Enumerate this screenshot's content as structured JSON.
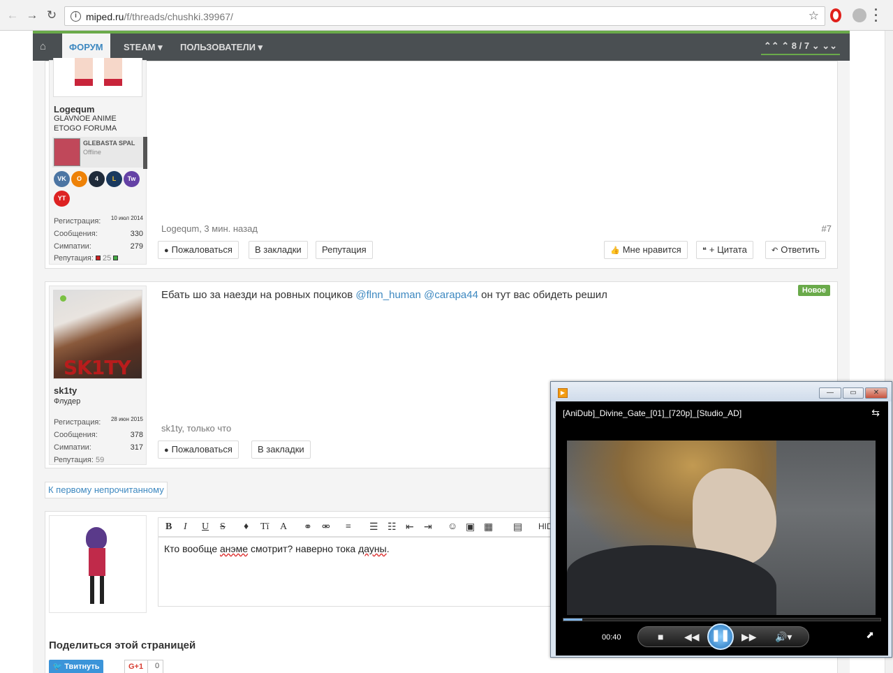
{
  "browser": {
    "url_host": "miped.ru",
    "url_path": "/f/threads/chushki.39967/"
  },
  "topnav": {
    "forum": "ФОРУМ",
    "steam": "STEAM ▾",
    "users": "ПОЛЬЗОВАТЕЛИ ▾",
    "pager": "⌃⌃ ⌃ 8 / 7 ⌄ ⌄⌄"
  },
  "post1": {
    "username": "Logequm",
    "usertitle": "GLAVNOE ANIME ETOGO FORUMA",
    "steam_name": "GLEBASTA SPAL",
    "steam_status": "Offline",
    "reg_label": "Регистрация:",
    "reg_value": "10 июл 2014",
    "msgs_label": "Сообщения:",
    "msgs_value": "330",
    "likes_label": "Симпатии:",
    "likes_value": "279",
    "rep_label": "Репутация:",
    "rep_value": "25",
    "meta": "Logequm, 3 мин. назад",
    "num": "#7",
    "report": "Пожаловаться",
    "bookmark": "В закладки",
    "reputation": "Репутация",
    "like": "Мне нравится",
    "quote": "+ Цитата",
    "reply": "Ответить",
    "social": [
      "VK",
      "O",
      "4",
      "L",
      "Tw",
      "YT"
    ]
  },
  "post2": {
    "username": "sk1ty",
    "usertitle": "Флудер",
    "avatar_text": "SK1TY",
    "message_before": "Ебать шо за наезди на ровных поциков ",
    "mention1": "@flnn_human",
    "mention2": "@carapa44",
    "message_after": " он тут вас обидеть решил",
    "badge": "Новое",
    "reg_label": "Регистрация:",
    "reg_value": "28 июн 2015",
    "msgs_label": "Сообщения:",
    "msgs_value": "378",
    "likes_label": "Симпатии:",
    "likes_value": "317",
    "rep_label": "Репутация:",
    "rep_value": "59",
    "meta": "sk1ty, только что",
    "report": "Пожаловаться",
    "bookmark": "В закладки"
  },
  "unread_link": "К первому непрочитанному",
  "editor": {
    "text_before": "Кто вообще ",
    "word1": "анэме",
    "text_mid": " смотрит? наверно тока ",
    "word2": "дауны",
    "text_end": ".",
    "hide_label": "HID"
  },
  "share": {
    "title": "Поделиться этой страницей",
    "tweet": "Твитнуть",
    "gplus": "G+1",
    "gplus_count": "0"
  },
  "player": {
    "title": "[AniDub]_Divine_Gate_[01]_[720p]_[Studio_AD]",
    "time": "00:40",
    "progress": 0.06
  },
  "colors": {
    "accent_green": "#6aaa4a",
    "link_blue": "#3d88c0",
    "nav_dark": "#4a4f52"
  }
}
